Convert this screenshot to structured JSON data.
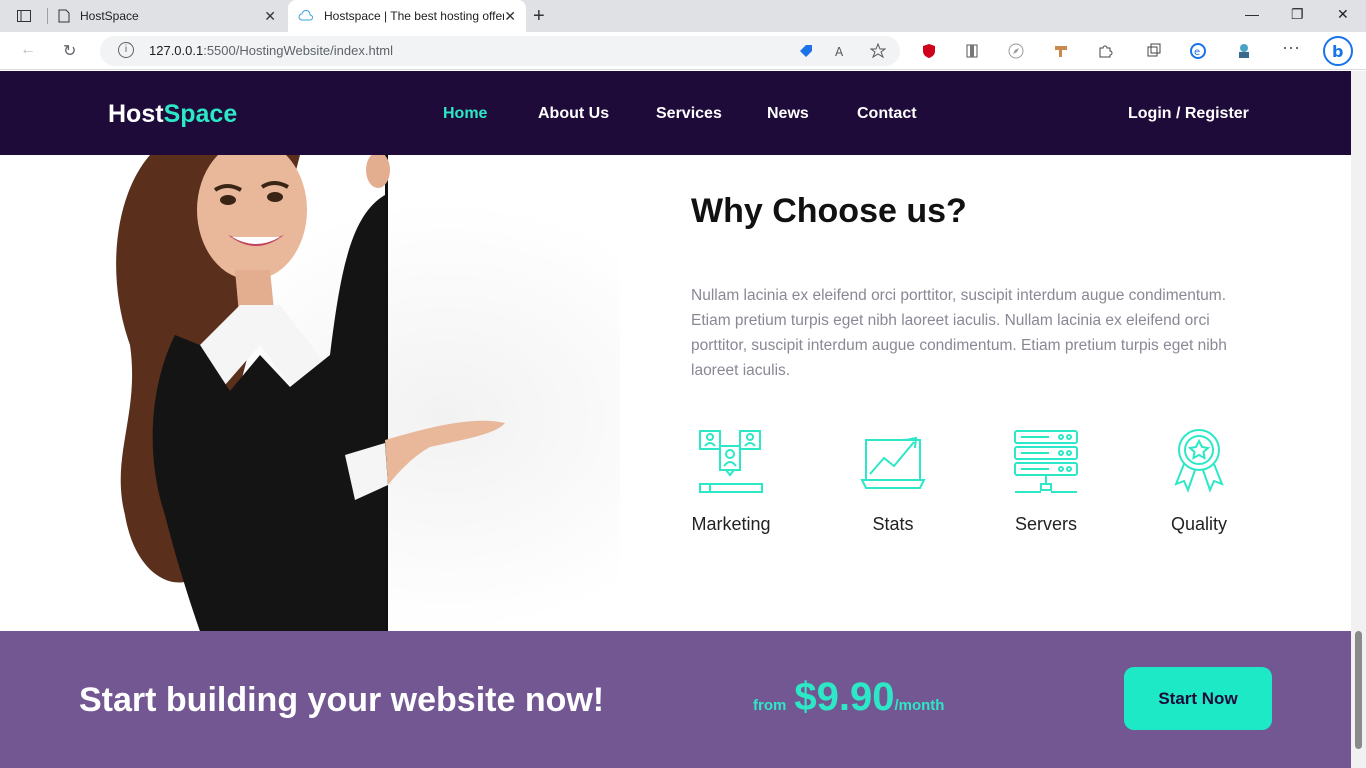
{
  "browser": {
    "tabs": [
      {
        "title": "HostSpace"
      },
      {
        "title": "Hostspace | The best hosting offer"
      }
    ],
    "url_host": "127.0.0.1",
    "url_path": ":5500/HostingWebsite/index.html"
  },
  "header": {
    "logo_main": "Host",
    "logo_accent": "Space",
    "nav": [
      "Home",
      "About Us",
      "Services",
      "News",
      "Contact"
    ],
    "auth": "Login / Register"
  },
  "why": {
    "title": "Why Choose us?",
    "text": "Nullam lacinia ex eleifend orci porttitor, suscipit interdum augue condimentum. Etiam pretium turpis eget nibh laoreet iaculis. Nullam lacinia ex eleifend orci porttitor, suscipit interdum augue condimentum. Etiam pretium turpis eget nibh laoreet iaculis.",
    "features": [
      {
        "label": "Marketing",
        "icon": "marketing-icon"
      },
      {
        "label": "Stats",
        "icon": "stats-icon"
      },
      {
        "label": "Servers",
        "icon": "servers-icon"
      },
      {
        "label": "Quality",
        "icon": "quality-icon"
      }
    ]
  },
  "cta": {
    "title": "Start building your website now!",
    "from": "from",
    "price": "$9.90",
    "per": "/month",
    "button": "Start Now"
  },
  "colors": {
    "header_bg": "#1e0b3a",
    "accent": "#2de8c6",
    "cta_bg": "#735792"
  }
}
